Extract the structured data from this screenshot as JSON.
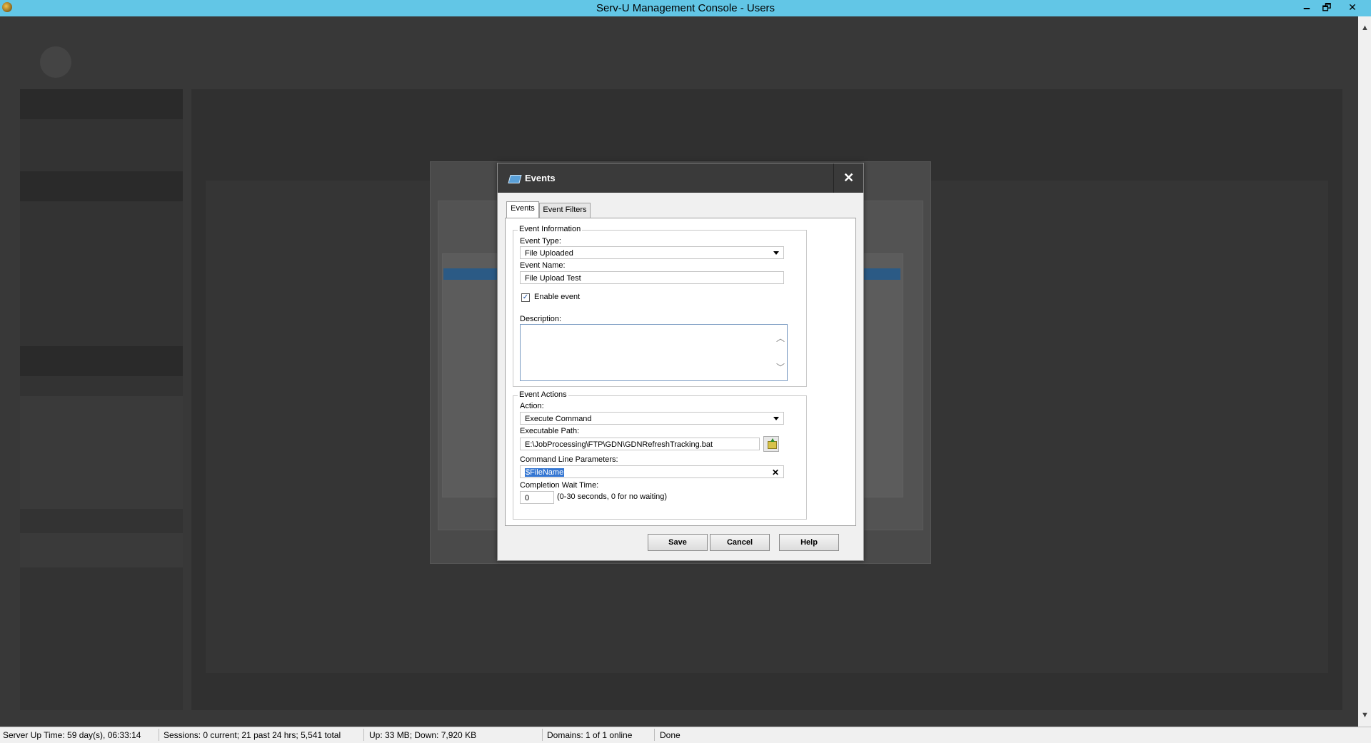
{
  "window": {
    "title": "Serv-U Management Console - Users",
    "minimize": "🗕",
    "restore": "🗗",
    "close": "✕"
  },
  "events_dialog": {
    "title": "Events",
    "close": "✕",
    "tabs": [
      {
        "label": "Events"
      },
      {
        "label": "Event Filters"
      }
    ],
    "event_information": {
      "legend": "Event Information",
      "event_type_label": "Event Type:",
      "event_type_value": "File Uploaded",
      "event_name_label": "Event Name:",
      "event_name_value": "File Upload Test",
      "enable_event_label": "Enable event",
      "enable_event_checked": "✓",
      "description_label": "Description:",
      "description_value": ""
    },
    "event_actions": {
      "legend": "Event Actions",
      "action_label": "Action:",
      "action_value": "Execute Command",
      "exec_path_label": "Executable Path:",
      "exec_path_value": "E:\\JobProcessing\\FTP\\GDN\\GDNRefreshTracking.bat",
      "cmd_params_label": "Command Line Parameters:",
      "cmd_params_value": "$FileName",
      "clear_glyph": "✕",
      "wait_time_label": "Completion Wait Time:",
      "wait_time_value": "0",
      "wait_time_hint": "(0-30 seconds, 0 for no waiting)"
    },
    "buttons": {
      "save": "Save",
      "cancel": "Cancel",
      "help": "Help"
    }
  },
  "status_bar": {
    "uptime": "Server Up Time: 59 day(s), 06:33:14",
    "sessions": "Sessions: 0 current; 21 past 24 hrs; 5,541 total",
    "transfer": "Up: 33 MB; Down: 7,920 KB",
    "domains": "Domains: 1 of 1 online",
    "state": "Done"
  },
  "colors": {
    "titlebar": "#62c6e6",
    "dialog_header": "#3a3a3a",
    "selection": "#3476d2"
  }
}
